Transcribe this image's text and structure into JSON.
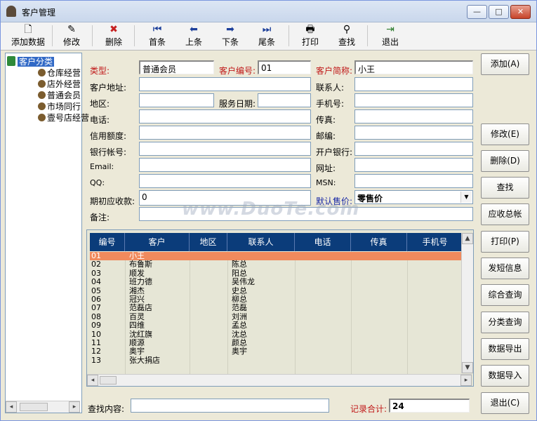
{
  "window": {
    "title": "客户管理",
    "minimize": "—",
    "maximize": "□",
    "close": "✕"
  },
  "toolbar": [
    {
      "label": "添加数据",
      "icon": "new-document-icon",
      "glyph": "🗋"
    },
    {
      "label": "修改",
      "icon": "edit-icon",
      "glyph": "✎"
    },
    {
      "label": "删除",
      "icon": "delete-icon",
      "glyph": "✖"
    },
    {
      "label": "首条",
      "icon": "first-record-icon",
      "glyph": "⏮"
    },
    {
      "label": "上条",
      "icon": "previous-record-icon",
      "glyph": "⬅"
    },
    {
      "label": "下条",
      "icon": "next-record-icon",
      "glyph": "➡"
    },
    {
      "label": "尾条",
      "icon": "last-record-icon",
      "glyph": "⏭"
    },
    {
      "label": "打印",
      "icon": "printer-icon",
      "glyph": "🖶"
    },
    {
      "label": "查找",
      "icon": "binoculars-icon",
      "glyph": "⚲"
    },
    {
      "label": "退出",
      "icon": "exit-door-icon",
      "glyph": "⇥"
    }
  ],
  "tree": {
    "root": "客户分类",
    "items": [
      "仓库经营",
      "店外经营",
      "普通会员",
      "市场同行",
      "壹号店经营"
    ],
    "scroll_left": "◂",
    "scroll_right": "▸"
  },
  "form": {
    "type_label": "类型:",
    "type_value": "普通会员",
    "code_label": "客户编号:",
    "code_value": "01",
    "short_name_label": "客户简称:",
    "short_name_value": "小王",
    "address_label": "客户地址:",
    "address_value": "",
    "contact_label": "联系人:",
    "contact_value": "",
    "region_label": "地区:",
    "region_value": "",
    "service_date_label": "服务日期:",
    "service_date_value": "",
    "mobile_label": "手机号:",
    "mobile_value": "",
    "phone_label": "电话:",
    "phone_value": "",
    "fax_label": "传真:",
    "fax_value": "",
    "credit_label": "信用额度:",
    "credit_value": "",
    "postcode_label": "邮编:",
    "postcode_value": "",
    "bank_account_label": "银行帐号:",
    "bank_account_value": "",
    "bank_label": "开户银行:",
    "bank_value": "",
    "email_label": "Email:",
    "email_value": "",
    "website_label": "网址:",
    "website_value": "",
    "qq_label": "QQ:",
    "qq_value": "",
    "msn_label": "MSN:",
    "msn_value": "",
    "opening_receivable_label": "期初应收款:",
    "opening_receivable_value": "0",
    "default_price_label": "默认售价:",
    "default_price_value": "零售价",
    "remark_label": "备注:",
    "remark_value": ""
  },
  "watermark": "www.DuoTe.com",
  "grid": {
    "columns": [
      "编号",
      "客户",
      "地区",
      "联系人",
      "电话",
      "传真",
      "手机号"
    ],
    "rows": [
      [
        "01",
        "小王",
        "",
        "",
        "",
        "",
        ""
      ],
      [
        "02",
        "布鲁斯",
        "",
        "陈总",
        "",
        "",
        ""
      ],
      [
        "03",
        "顺发",
        "",
        "阳总",
        "",
        "",
        ""
      ],
      [
        "04",
        "班力德",
        "",
        "吴伟龙",
        "",
        "",
        ""
      ],
      [
        "05",
        "湘杰",
        "",
        "史总",
        "",
        "",
        ""
      ],
      [
        "06",
        "冠兴",
        "",
        "柳总",
        "",
        "",
        ""
      ],
      [
        "07",
        "范磊店",
        "",
        "范磊",
        "",
        "",
        ""
      ],
      [
        "08",
        "百灵",
        "",
        "刘洲",
        "",
        "",
        ""
      ],
      [
        "09",
        "四维",
        "",
        "孟总",
        "",
        "",
        ""
      ],
      [
        "10",
        "沈红旗",
        "",
        "沈总",
        "",
        "",
        ""
      ],
      [
        "11",
        "顺源",
        "",
        "颜总",
        "",
        "",
        ""
      ],
      [
        "12",
        "奥宇",
        "",
        "奥宇",
        "",
        "",
        ""
      ],
      [
        "13",
        "张大捐店",
        "",
        "",
        "",
        "",
        ""
      ]
    ]
  },
  "side_buttons": [
    "添加(A)",
    "修改(E)",
    "删除(D)",
    "查找",
    "应收总帐",
    "打印(P)",
    "发短信息",
    "综合查询",
    "分类查询",
    "数据导出",
    "数据导入",
    "退出(C)"
  ],
  "bottom": {
    "search_label": "查找内容:",
    "search_value": "",
    "total_label": "记录合计:",
    "total_value": "24"
  }
}
